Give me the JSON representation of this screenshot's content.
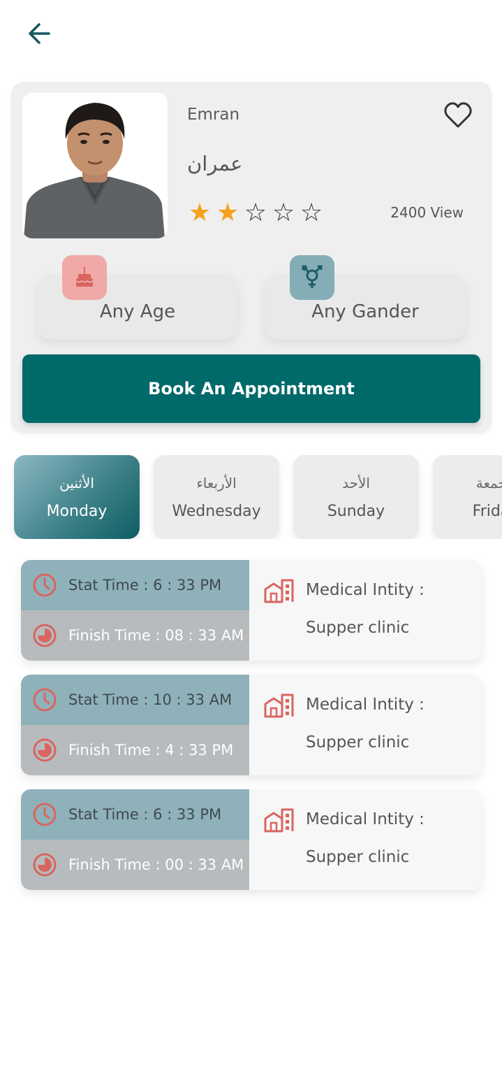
{
  "header": {
    "back_icon": "arrow-left-icon"
  },
  "doctor": {
    "name_en": "Emran",
    "name_ar": "عمران",
    "rating": 2,
    "rating_max": 5,
    "views": "2400 View",
    "favorite_icon": "heart-outline-icon"
  },
  "info": {
    "age_label": "Any Age",
    "age_icon": "cake-icon",
    "gender_label": "Any Gander",
    "gender_icon": "gender-icon"
  },
  "book_label": "Book An Appointment",
  "days": [
    {
      "ar": "الأثنين",
      "en": "Monday",
      "active": true
    },
    {
      "ar": "الأربعاء",
      "en": "Wednesday",
      "active": false
    },
    {
      "ar": "الأحد",
      "en": "Sunday",
      "active": false
    },
    {
      "ar": "الجمعة",
      "en": "Friday",
      "active": false
    }
  ],
  "schedule": [
    {
      "start": "Stat Time : 6 : 33 PM",
      "finish": "Finish Time : 08 : 33 AM",
      "entity_label": "Medical Intity :",
      "entity_value": "Supper clinic"
    },
    {
      "start": "Stat Time : 10 : 33 AM",
      "finish": "Finish Time : 4 : 33 PM",
      "entity_label": "Medical Intity :",
      "entity_value": "Supper clinic"
    },
    {
      "start": "Stat Time : 6 : 33 PM",
      "finish": "Finish Time : 00 : 33 AM",
      "entity_label": "Medical Intity :",
      "entity_value": "Supper clinic"
    }
  ],
  "colors": {
    "primary": "#00696a",
    "start_row": "#8fb1ba",
    "finish_row": "#b7bbbd",
    "accent_red": "#d9655f",
    "star": "#f5a11c"
  }
}
